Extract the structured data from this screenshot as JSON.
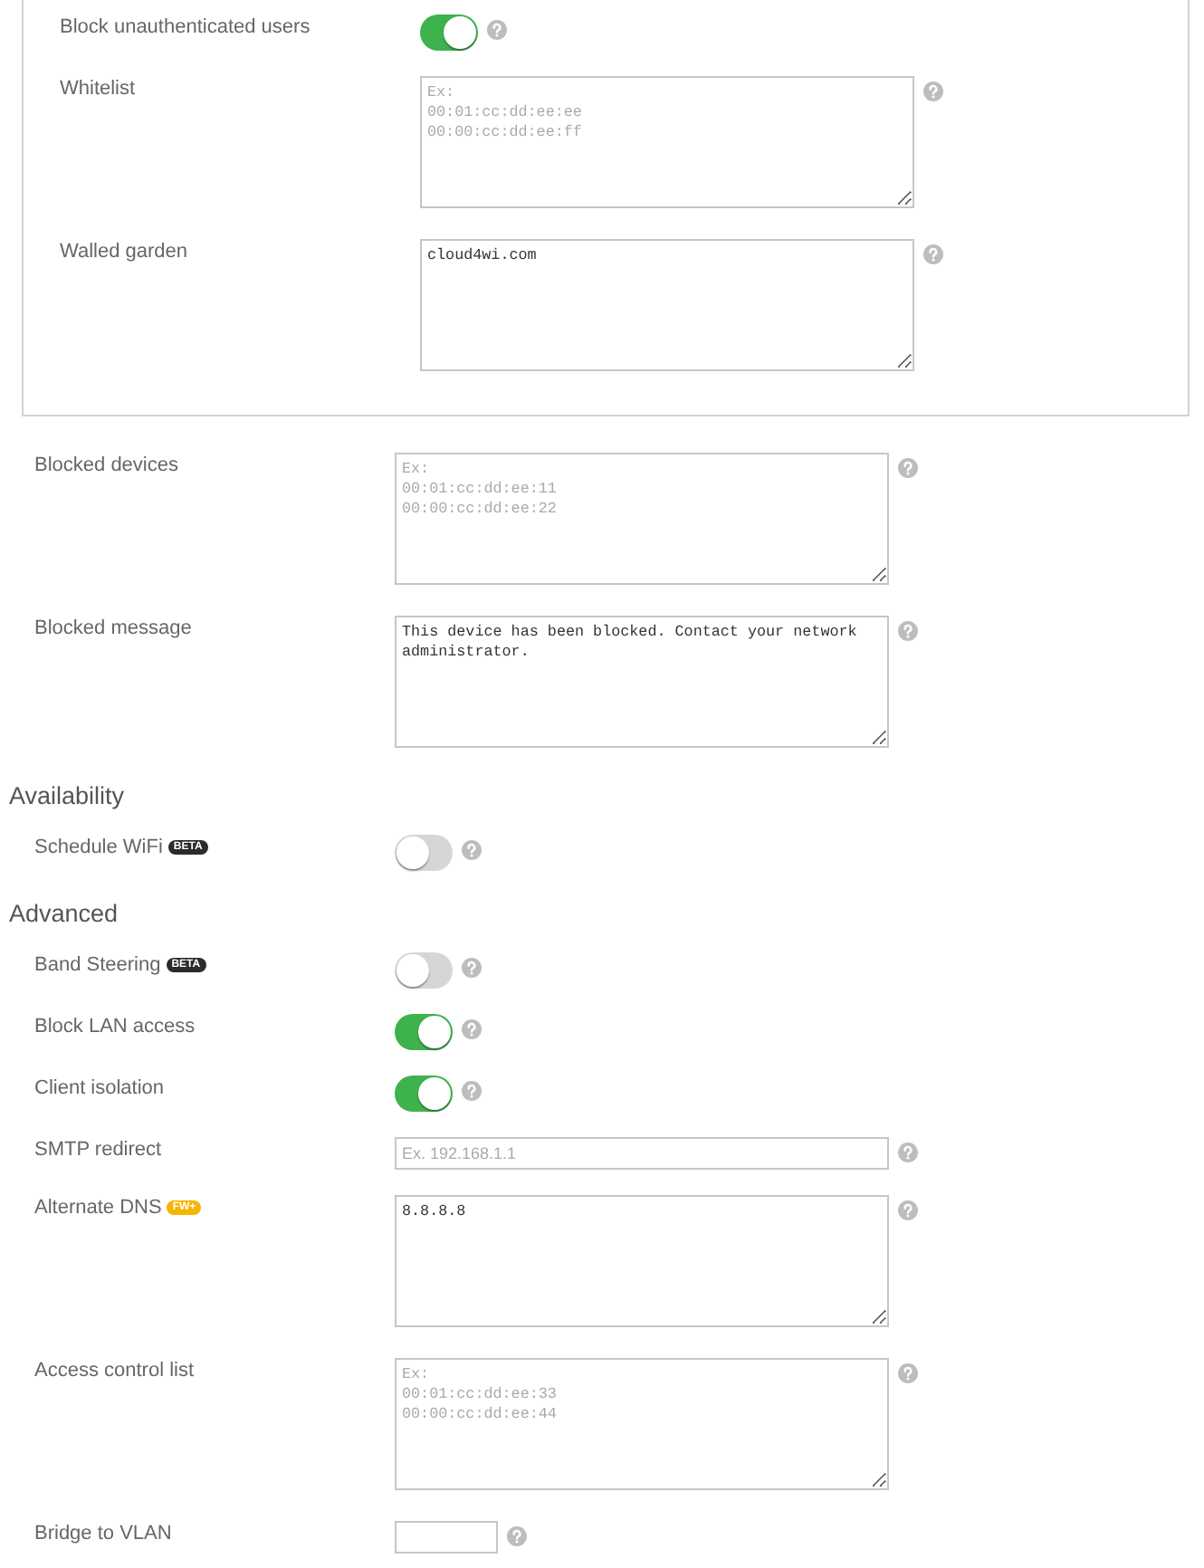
{
  "top_panel": {
    "rows": [
      {
        "kind": "toggle",
        "label": "Block unauthenticated users",
        "on": true
      },
      {
        "kind": "textarea",
        "label": "Whitelist",
        "placeholder": "Ex:\n00:01:cc:dd:ee:ee\n00:00:cc:dd:ee:ff"
      },
      {
        "kind": "textarea",
        "label": "Walled garden",
        "value": "cloud4wi.com"
      }
    ]
  },
  "rows": [
    {
      "kind": "textarea",
      "label": "Blocked devices",
      "placeholder": "Ex:\n00:01:cc:dd:ee:11\n00:00:cc:dd:ee:22"
    },
    {
      "kind": "textarea",
      "label": "Blocked message",
      "value": "This device has been blocked. Contact your network administrator."
    }
  ],
  "sections": [
    {
      "heading": "Availability",
      "rows": [
        {
          "kind": "toggle",
          "label": "Schedule WiFi",
          "badge": {
            "text": "BETA",
            "kind": "beta"
          },
          "on": false
        }
      ]
    },
    {
      "heading": "Advanced",
      "rows": [
        {
          "kind": "toggle",
          "label": "Band Steering",
          "badge": {
            "text": "BETA",
            "kind": "beta"
          },
          "on": false
        },
        {
          "kind": "toggle",
          "label": "Block LAN access",
          "on": true
        },
        {
          "kind": "toggle",
          "label": "Client isolation",
          "on": true
        },
        {
          "kind": "input",
          "label": "SMTP redirect",
          "placeholder": "Ex. 192.168.1.1"
        },
        {
          "kind": "textarea",
          "label": "Alternate DNS",
          "badge": {
            "text": "FW+",
            "kind": "firmware"
          },
          "value": "8.8.8.8"
        },
        {
          "kind": "textarea",
          "label": "Access control list",
          "placeholder": "Ex:\n00:01:cc:dd:ee:33\n00:00:cc:dd:ee:44"
        },
        {
          "kind": "short_input",
          "label": "Bridge to VLAN"
        }
      ]
    }
  ]
}
